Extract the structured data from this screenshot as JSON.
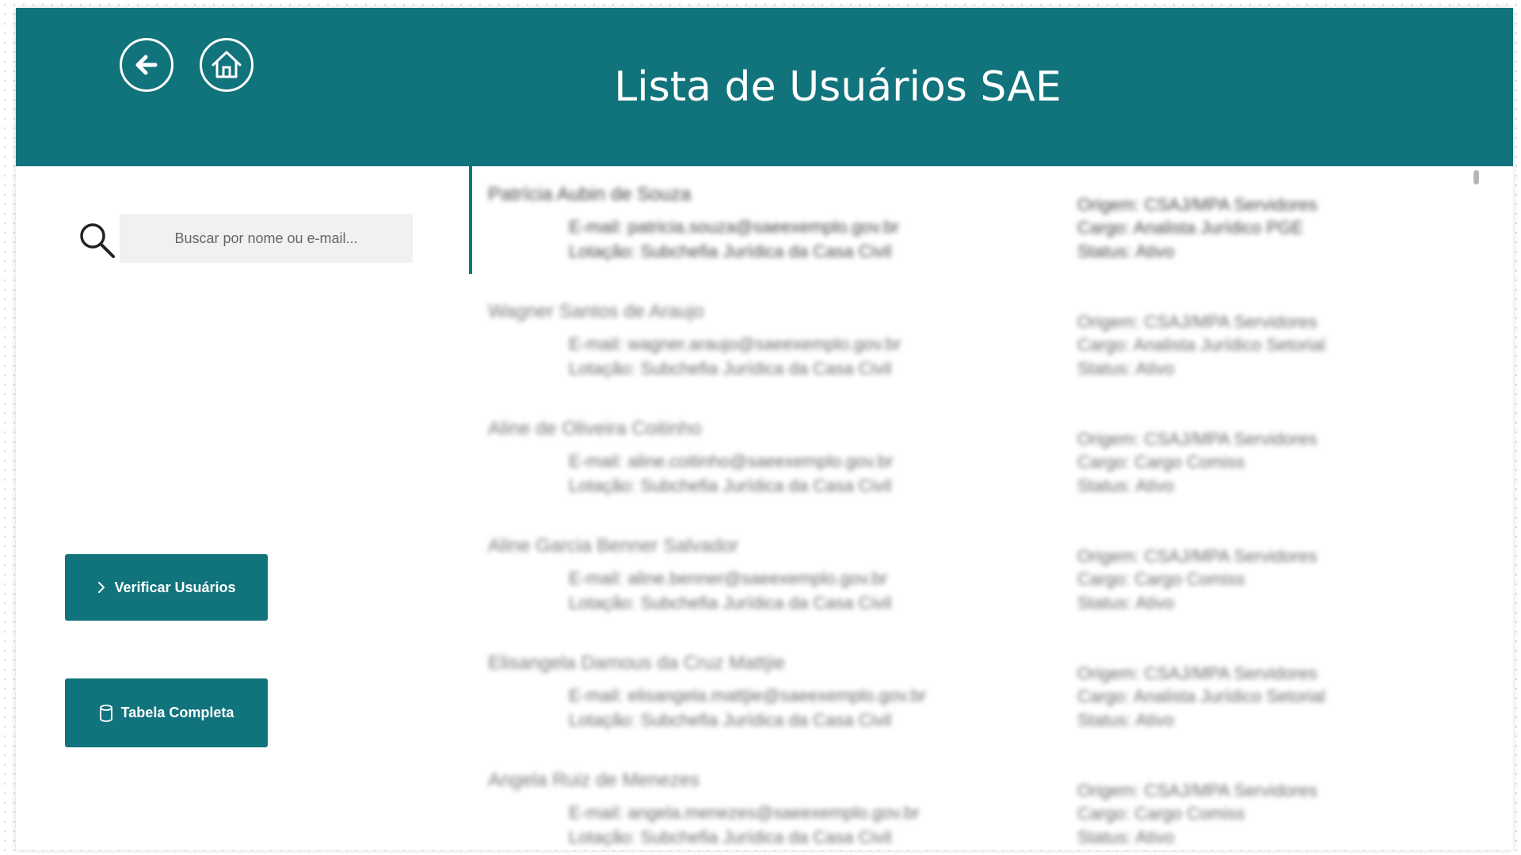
{
  "header": {
    "title": "Lista de Usuários SAE",
    "background_color": "#11737c",
    "back_icon": "arrow-left-icon",
    "home_icon": "home-icon"
  },
  "search": {
    "icon": "search-icon",
    "placeholder": "Buscar por nome ou e-mail..."
  },
  "actions": {
    "verify_label": "Verificar Usuários",
    "verify_icon": "chevron-right-icon",
    "table_label": "Tabela Completa",
    "table_icon": "database-icon"
  },
  "users": [
    {
      "name": "Patrícia Aubin de Souza",
      "email": "E-mail: patricia.souza@saeexemplo.gov.br",
      "lotacao": "Lotação: Subchefia Jurídica da Casa Civil",
      "origem": "Origem: CSAJ/MPA Servidores",
      "cargo": "Cargo: Analista Jurídico PGE",
      "status": "Status: Ativo"
    },
    {
      "name": "Wagner Santos de Araujo",
      "email": "E-mail: wagner.araujo@saeexemplo.gov.br",
      "lotacao": "Lotação: Subchefia Jurídica da Casa Civil",
      "origem": "Origem: CSAJ/MPA Servidores",
      "cargo": "Cargo: Analista Jurídico Setorial",
      "status": "Status: Ativo"
    },
    {
      "name": "Aline de Oliveira Coitinho",
      "email": "E-mail: aline.coitinho@saeexemplo.gov.br",
      "lotacao": "Lotação: Subchefia Jurídica da Casa Civil",
      "origem": "Origem: CSAJ/MPA Servidores",
      "cargo": "Cargo: Cargo Comiss",
      "status": "Status: Ativo"
    },
    {
      "name": "Aline Garcia Benner Salvador",
      "email": "E-mail: aline.benner@saeexemplo.gov.br",
      "lotacao": "Lotação: Subchefia Jurídica da Casa Civil",
      "origem": "Origem: CSAJ/MPA Servidores",
      "cargo": "Cargo: Cargo Comiss",
      "status": "Status: Ativo"
    },
    {
      "name": "Elisangela Damous da Cruz Mattjie",
      "email": "E-mail: elisangela.mattjie@saeexemplo.gov.br",
      "lotacao": "Lotação: Subchefia Jurídica da Casa Civil",
      "origem": "Origem: CSAJ/MPA Servidores",
      "cargo": "Cargo: Analista Jurídico Setorial",
      "status": "Status: Ativo"
    },
    {
      "name": "Angela Ruiz de Menezes",
      "email": "E-mail: angela.menezes@saeexemplo.gov.br",
      "lotacao": "Lotação: Subchefia Jurídica da Casa Civil",
      "origem": "Origem: CSAJ/MPA Servidores",
      "cargo": "Cargo: Cargo Comiss",
      "status": "Status: Ativo"
    }
  ]
}
